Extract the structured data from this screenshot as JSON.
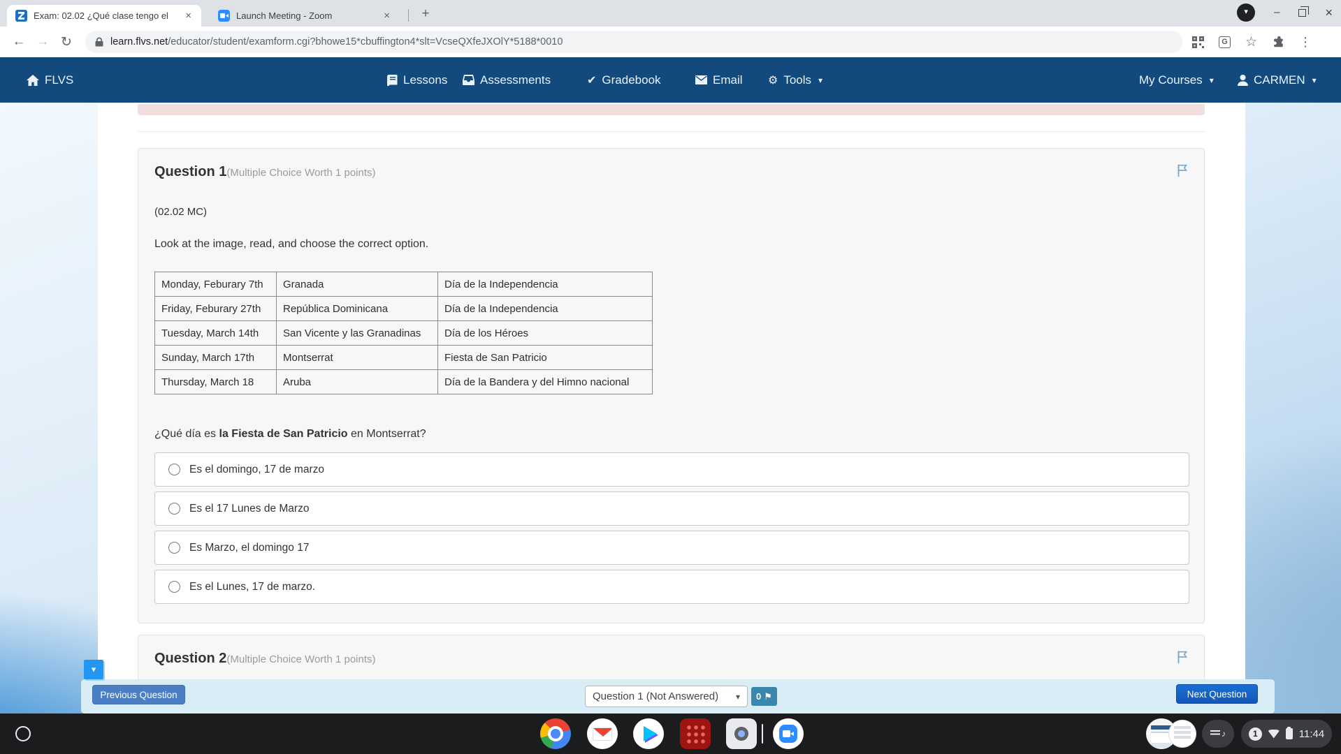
{
  "browser": {
    "tabs": [
      {
        "title": "Exam: 02.02 ¿Qué clase tengo el"
      },
      {
        "title": "Launch Meeting - Zoom"
      }
    ],
    "url_domain": "learn.flvs.net",
    "url_rest": "/educator/student/examform.cgi?bhowe15*cbuffington4*slt=VcseQXfeJXOlY*5188*0010"
  },
  "navbar": {
    "brand": "FLVS",
    "lessons": "Lessons",
    "assessments": "Assessments",
    "gradebook": "Gradebook",
    "email": "Email",
    "tools": "Tools",
    "my_courses": "My Courses",
    "user": "CARMEN"
  },
  "exam": {
    "question1": {
      "title": "Question 1",
      "meta": "(Multiple Choice Worth 1 points)",
      "code": "(02.02 MC)",
      "instruction": "Look at the image, read, and choose the correct option.",
      "table": [
        [
          "Monday, Feburary 7th",
          "Granada",
          "Día de la Independencia"
        ],
        [
          "Friday, Feburary 27th",
          "República Dominicana",
          "Día de la Independencia"
        ],
        [
          "Tuesday, March 14th",
          "San Vicente y las Granadinas",
          "Día de los Héroes"
        ],
        [
          "Sunday, March 17th",
          "Montserrat",
          "Fiesta de San Patricio"
        ],
        [
          "Thursday, March 18",
          "Aruba",
          "Día de la Bandera y del Himno nacional"
        ]
      ],
      "prompt_pre": "¿Qué día es ",
      "prompt_bold": "la Fiesta de San Patricio",
      "prompt_post": " en Montserrat?",
      "options": [
        "Es el domingo, 17 de marzo",
        "Es el 17 Lunes de Marzo",
        "Es Marzo, el domingo 17",
        "Es el Lunes, 17 de marzo."
      ]
    },
    "question2": {
      "title": "Question 2",
      "meta": "(Multiple Choice Worth 1 points)"
    },
    "footer": {
      "prev_label": "Previous Question",
      "next_label": "Next Question",
      "selector_value": "Question 1 (Not Answered)",
      "flag_count": "0"
    }
  },
  "shelf": {
    "time": "11:44",
    "notification_count": "1"
  },
  "glyphs": {
    "close": "×",
    "plus": "+",
    "back": "←",
    "forward": "→",
    "reload": "↻",
    "star": "☆",
    "menu": "⋮",
    "caret": "▾",
    "check": "✔",
    "gear": "⚙",
    "minus": "–",
    "flag": "⚑",
    "note": "♪",
    "translate_letter": "G"
  },
  "colors": {
    "navbar_navy": "#134a7e",
    "alert_pink": "#f2dede",
    "footer_bg": "#d9edf7",
    "prev_button": "#4a7ec5",
    "next_button": "#1257b8",
    "flag_badge": "#3a87ad",
    "caret_button": "#2196f3"
  }
}
